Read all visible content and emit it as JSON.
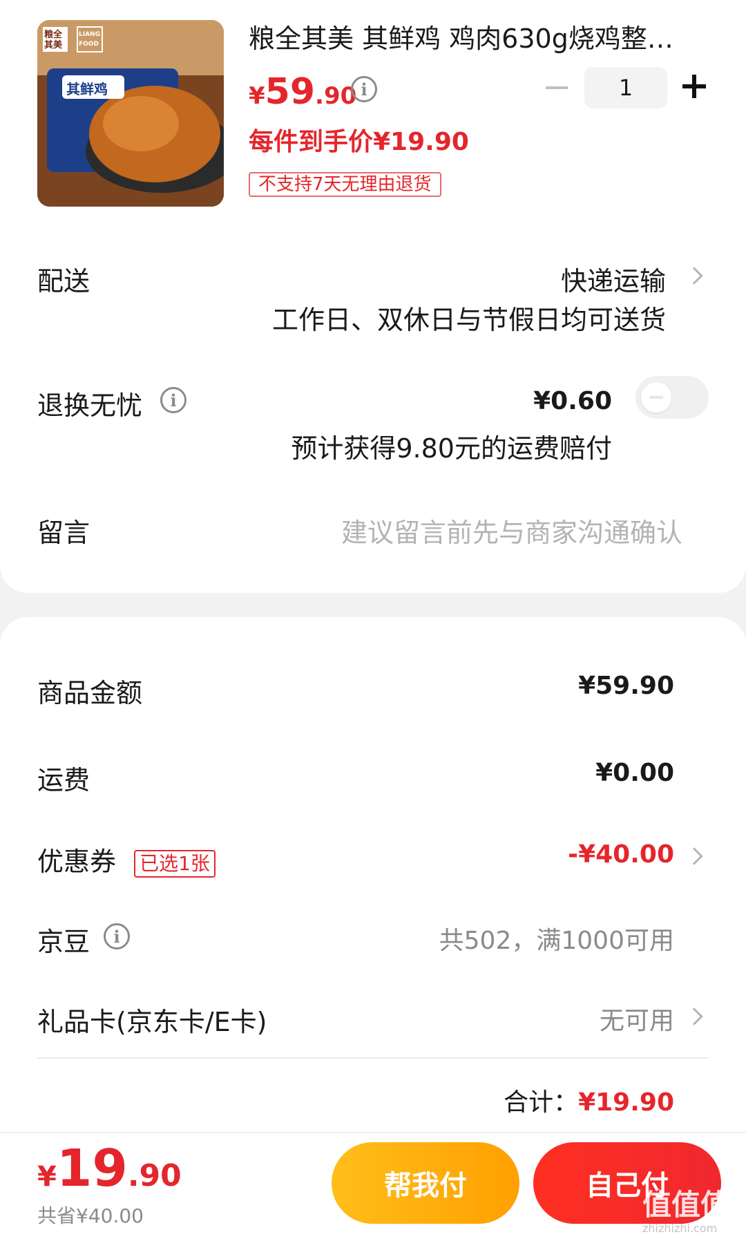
{
  "product": {
    "title": "粮全其美 其鲜鸡 鸡肉630g烧鸡整只...",
    "price_currency": "¥",
    "price_int": "59",
    "price_dec": ".90",
    "deal_price": "每件到手价¥19.90",
    "no_return_tag": "不支持7天无理由退货",
    "quantity": "1",
    "image_brand_tl": "粮全其美",
    "image_brand_tr": "LIANG FOOD",
    "image_badge": "其鲜鸡"
  },
  "delivery": {
    "label": "配送",
    "method": "快递运输",
    "note": "工作日、双休日与节假日均可送货"
  },
  "return_insurance": {
    "label": "退换无忧",
    "price": "¥0.60",
    "note": "预计获得9.80元的运费赔付",
    "enabled": false
  },
  "message": {
    "label": "留言",
    "placeholder": "建议留言前先与商家沟通确认"
  },
  "summary": {
    "goods_label": "商品金额",
    "goods_value": "¥59.90",
    "shipping_label": "运费",
    "shipping_value": "¥0.00",
    "coupon_label": "优惠券",
    "coupon_tag": "已选1张",
    "coupon_value": "-¥40.00",
    "beans_label": "京豆",
    "beans_value": "共502，满1000可用",
    "giftcard_label": "礼品卡(京东卡/E卡)",
    "giftcard_value": "无可用",
    "total_label": "合计：",
    "total_value": "¥19.90"
  },
  "footer": {
    "currency": "¥",
    "amount_int": "19",
    "amount_dec": ".90",
    "saved": "共省¥40.00",
    "help_pay_label": "帮我付",
    "self_pay_label": "自己付"
  },
  "watermark": {
    "logo": "值值值",
    "site": "zhizhizhi.com"
  },
  "colors": {
    "accent_red": "#e4262c",
    "help_yellow": "#ffb000",
    "self_red": "#f22a24"
  }
}
